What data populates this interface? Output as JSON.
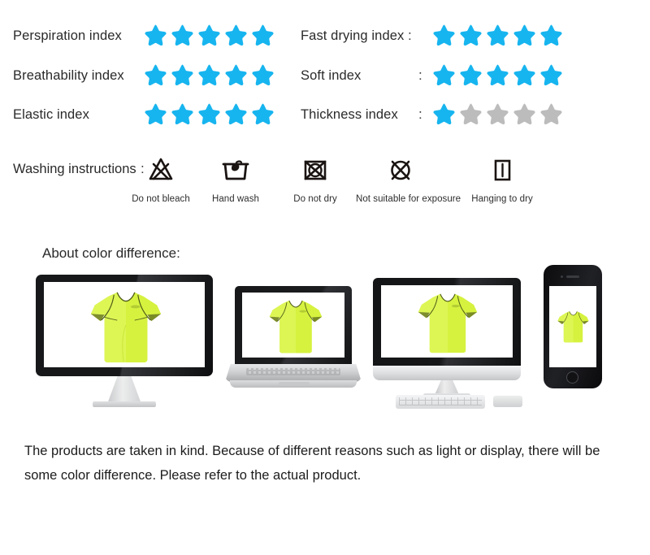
{
  "indices": {
    "left": [
      {
        "label": "Perspiration index",
        "filled": 5,
        "total": 5
      },
      {
        "label": "Breathability index",
        "filled": 5,
        "total": 5
      },
      {
        "label": "Elastic index",
        "filled": 5,
        "total": 5
      }
    ],
    "right": [
      {
        "label": "Fast drying index",
        "colon": ":",
        "filled": 5,
        "total": 5
      },
      {
        "label": "Soft index",
        "colon": ":",
        "filled": 5,
        "total": 5
      },
      {
        "label": "Thickness index",
        "colon": ":",
        "filled": 1,
        "total": 5
      }
    ]
  },
  "washing": {
    "label": "Washing instructions",
    "colon": ":",
    "items": [
      {
        "icon": "do-not-bleach-icon",
        "caption": "Do not bleach"
      },
      {
        "icon": "hand-wash-icon",
        "caption": "Hand wash"
      },
      {
        "icon": "do-not-tumble-dry-icon",
        "caption": "Do not dry"
      },
      {
        "icon": "no-sun-exposure-icon",
        "caption": "Not suitable for exposure"
      },
      {
        "icon": "hang-to-dry-icon",
        "caption": "Hanging to dry"
      }
    ]
  },
  "color_difference": {
    "title": "About color difference:",
    "devices": [
      {
        "name": "desktop-monitor"
      },
      {
        "name": "laptop"
      },
      {
        "name": "all-in-one-computer"
      },
      {
        "name": "smartphone"
      }
    ],
    "disclaimer": "The products are taken in kind. Because of different reasons such as light or display, there will be some color difference. Please refer to the actual product."
  },
  "colors": {
    "star_filled": "#17b5ef",
    "star_empty": "#bcbcbc",
    "text": "#2a2a2a",
    "shirt": "#d6f23f",
    "shirt_shadow": "#b9dd2b",
    "shirt_seam": "#5c6a1e",
    "background": "#ffffff"
  }
}
